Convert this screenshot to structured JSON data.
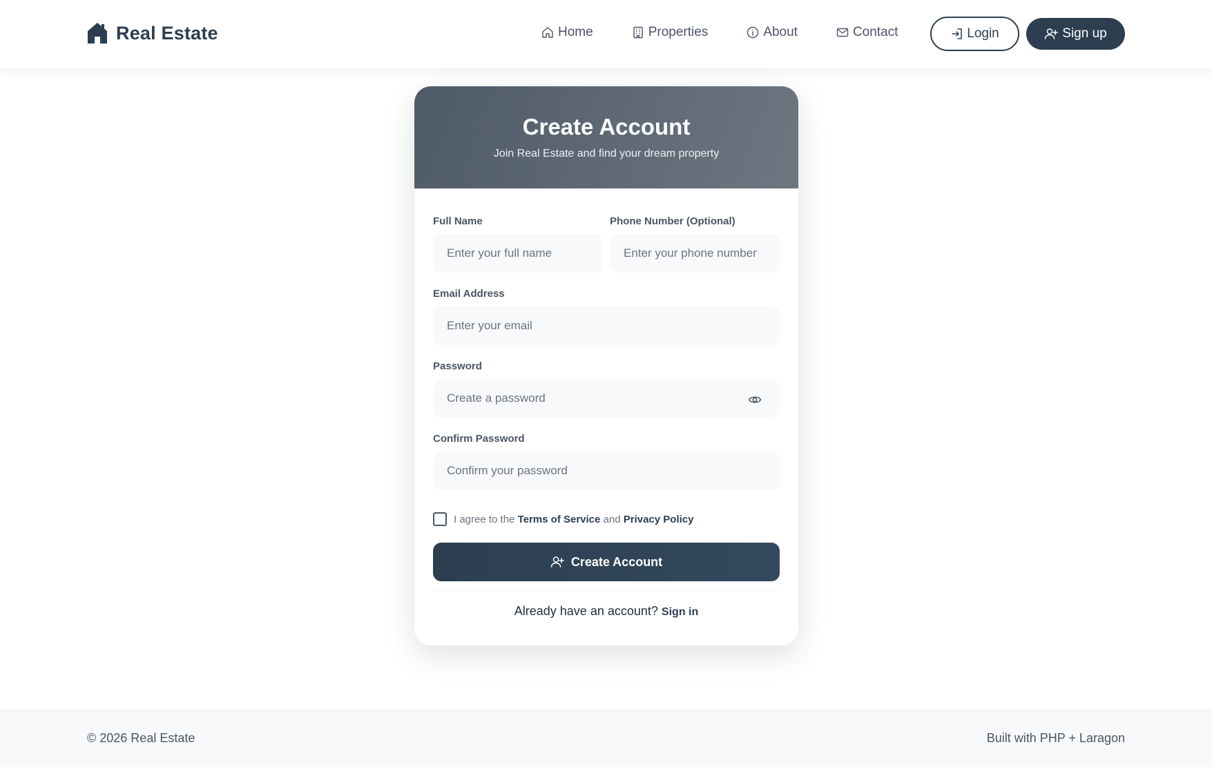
{
  "brand": {
    "name": "Real Estate",
    "icon": "house-icon"
  },
  "nav": {
    "items": [
      {
        "label": "Home",
        "icon": "home-icon"
      },
      {
        "label": "Properties",
        "icon": "building-icon"
      },
      {
        "label": "About",
        "icon": "info-icon"
      },
      {
        "label": "Contact",
        "icon": "envelope-icon"
      }
    ],
    "login_label": "Login",
    "signup_label": "Sign up"
  },
  "card": {
    "title": "Create Account",
    "subtitle": "Join Real Estate and find your dream property",
    "fields": {
      "full_name": {
        "label": "Full Name",
        "placeholder": "Enter your full name",
        "value": ""
      },
      "phone": {
        "label": "Phone Number (Optional)",
        "placeholder": "Enter your phone number",
        "value": ""
      },
      "email": {
        "label": "Email Address",
        "placeholder": "Enter your email",
        "value": ""
      },
      "password": {
        "label": "Password",
        "placeholder": "Create a password",
        "value": ""
      },
      "confirm_password": {
        "label": "Confirm Password",
        "placeholder": "Confirm your password",
        "value": ""
      }
    },
    "agree": {
      "prefix": "I agree to the",
      "terms": "Terms of Service",
      "and": "and",
      "privacy": "Privacy Policy",
      "checked": false
    },
    "submit_label": "Create Account",
    "signin_prompt": "Already have an account?",
    "signin_link": "Sign in"
  },
  "footer": {
    "copyright": "© 2026 Real Estate",
    "built_with": "Built with PHP + Laragon"
  },
  "colors": {
    "primary": "#2c3e50",
    "header_gradient_start": "#4f5a67",
    "header_gradient_end": "#6d7781",
    "input_bg": "#f8f9fa",
    "text_muted": "#4b5563"
  }
}
